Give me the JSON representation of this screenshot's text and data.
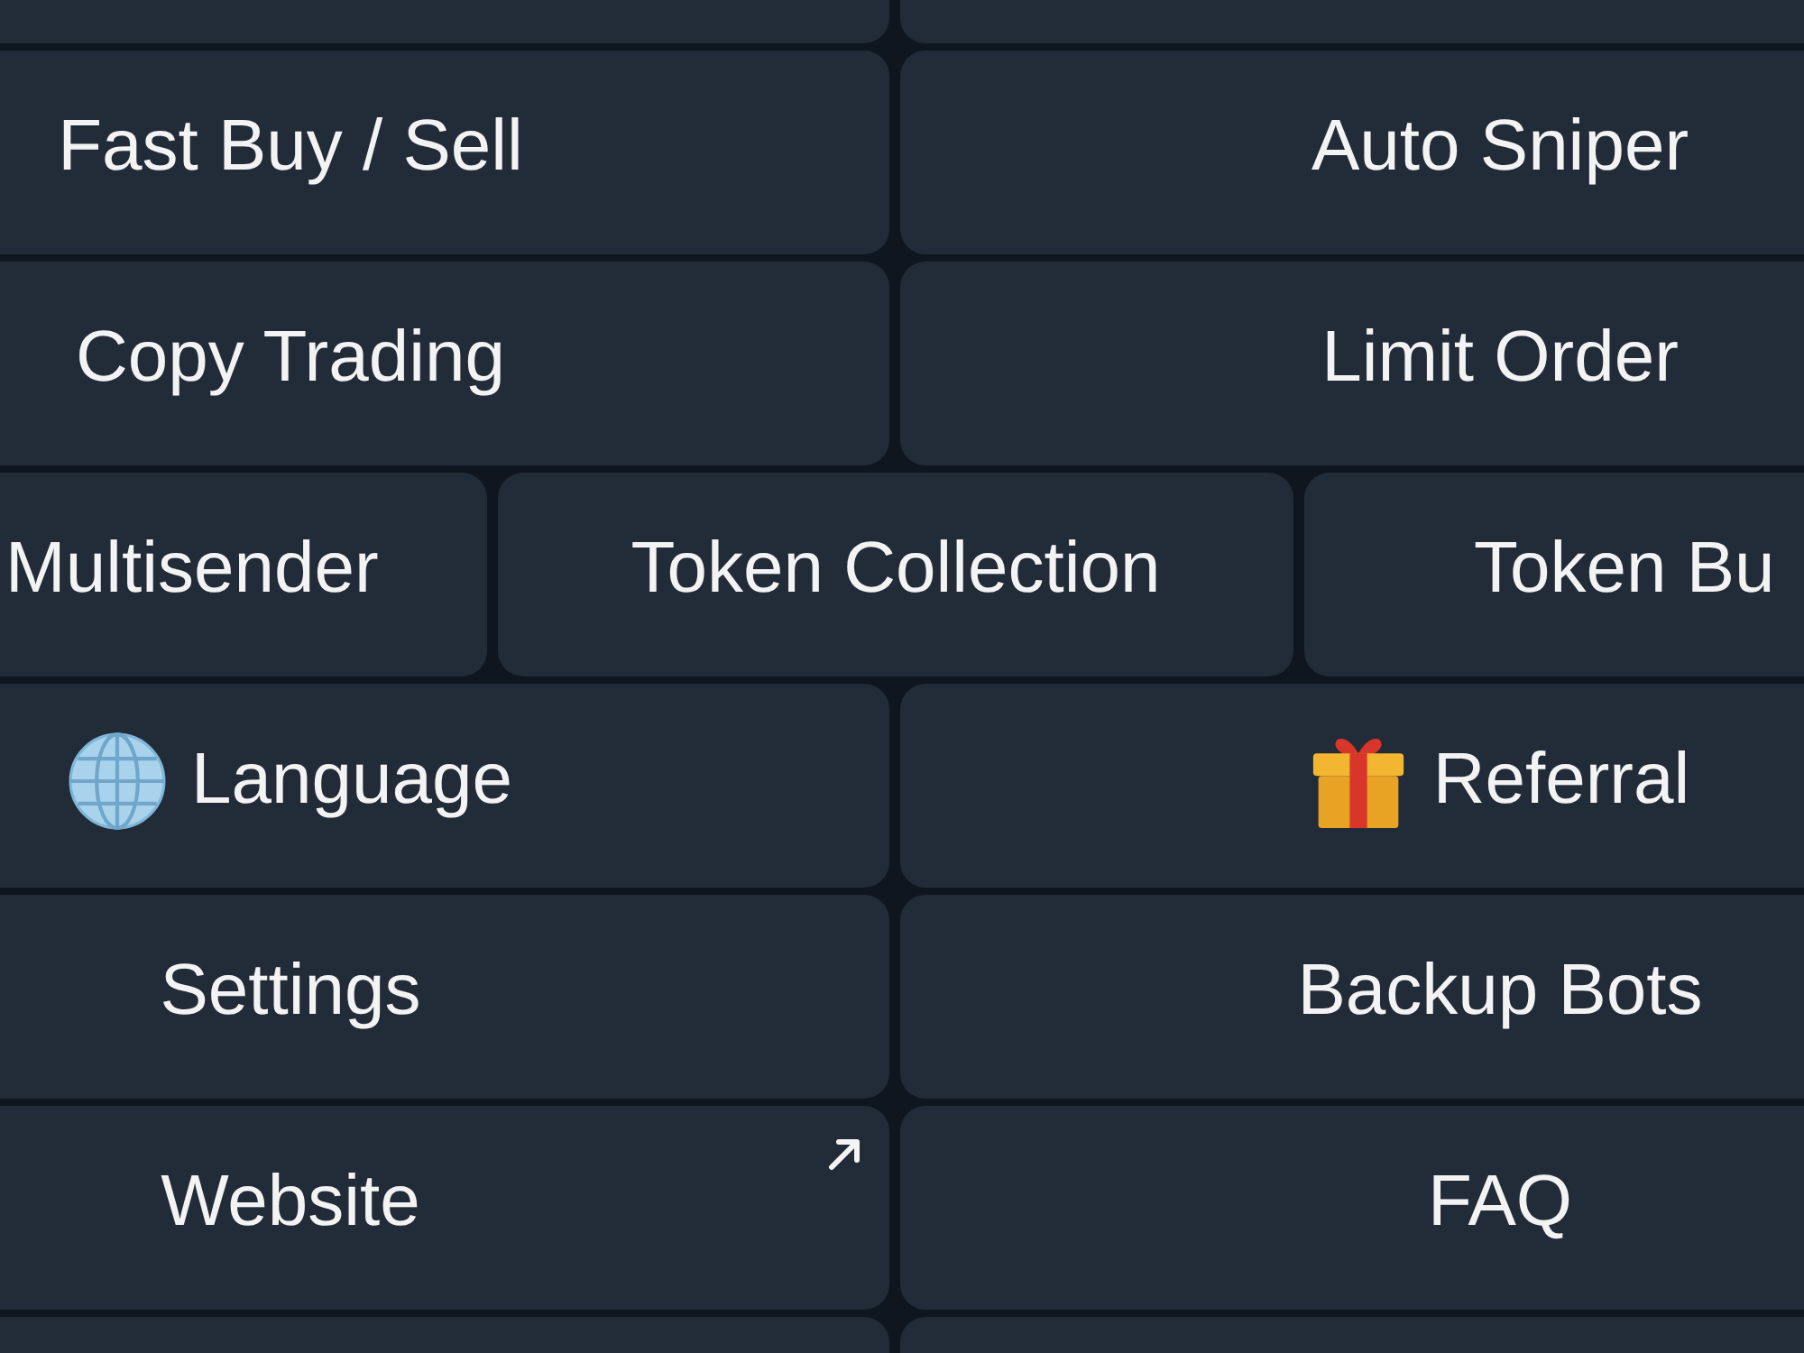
{
  "keyboard": {
    "rows": [
      {
        "buttons": [
          {
            "label": "Fast Buy / Sell",
            "kind": "callback"
          },
          {
            "label": "Auto Sniper",
            "kind": "callback"
          }
        ]
      },
      {
        "buttons": [
          {
            "label": "Copy Trading",
            "kind": "callback"
          },
          {
            "label": "Limit Order",
            "kind": "callback"
          }
        ]
      },
      {
        "buttons": [
          {
            "label": "Multisender",
            "kind": "callback"
          },
          {
            "label": "Token Collection",
            "kind": "callback"
          },
          {
            "label": "Token Bu",
            "kind": "callback"
          }
        ]
      },
      {
        "buttons": [
          {
            "label": "Language",
            "kind": "callback"
          },
          {
            "label": "Referral",
            "kind": "callback"
          }
        ]
      },
      {
        "buttons": [
          {
            "label": "Settings",
            "kind": "callback"
          },
          {
            "label": "Backup Bots",
            "kind": "callback"
          }
        ]
      },
      {
        "buttons": [
          {
            "label": "Website",
            "kind": "url"
          },
          {
            "label": "FAQ",
            "kind": "callback"
          }
        ]
      }
    ]
  }
}
